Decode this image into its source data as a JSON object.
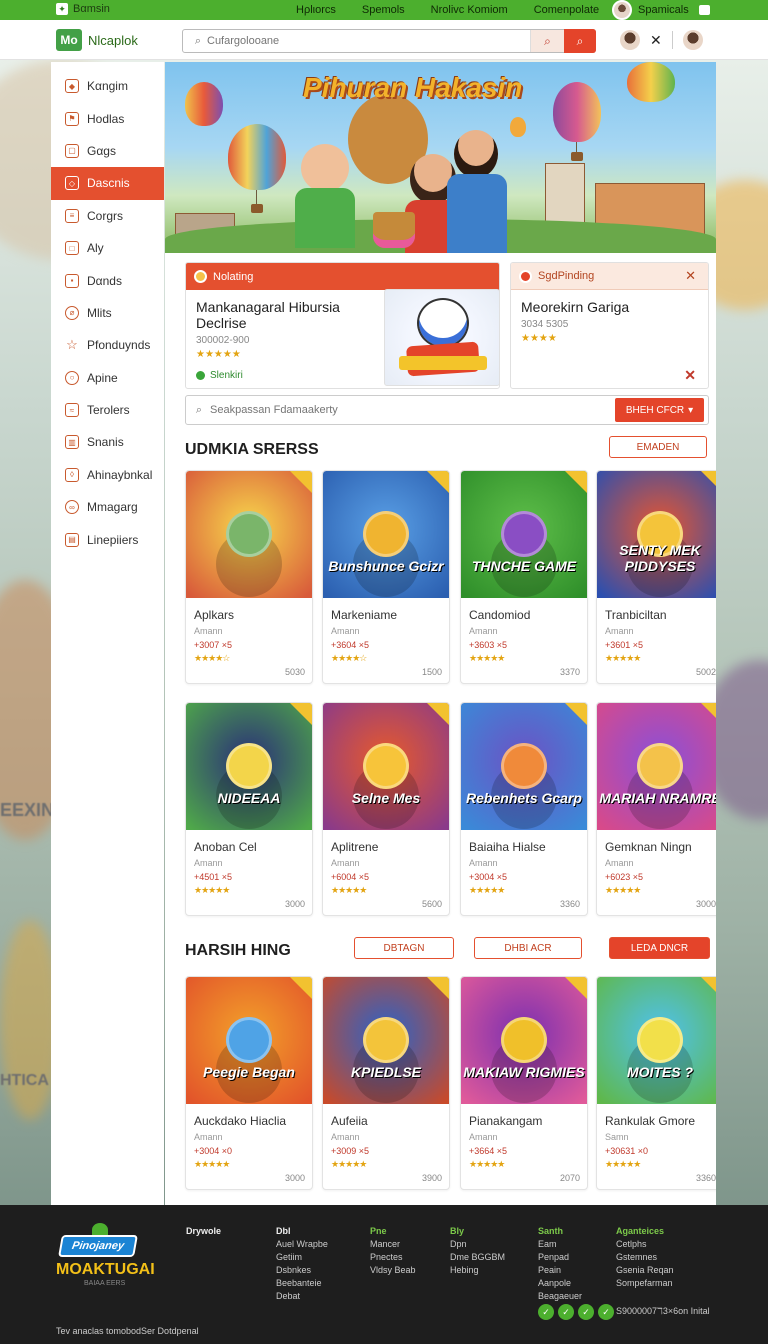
{
  "topbar": {
    "brand": "Bαmsin",
    "nav": [
      "Hρlιorcs",
      "Spemols",
      "Nrolivc Komiom",
      "Comenpolate"
    ],
    "account": "Spamicals"
  },
  "header": {
    "logo_mark": "Mo",
    "logo_text": "Nlcaplok",
    "search_placeholder": "Cufargolooane"
  },
  "sidebar": {
    "items": [
      {
        "label": "Kαngim",
        "icon": "tag-icon"
      },
      {
        "label": "Hodlas",
        "icon": "flag-icon"
      },
      {
        "label": "Gαgs",
        "icon": "gift-icon"
      },
      {
        "label": "Dascnis",
        "icon": "tag-icon",
        "active": true
      },
      {
        "label": "Corgrs",
        "icon": "document-icon"
      },
      {
        "label": "Aly",
        "icon": "box-icon"
      },
      {
        "label": "Dαnds",
        "icon": "square-icon"
      },
      {
        "label": "Mlits",
        "icon": "circle-slash-icon"
      },
      {
        "label": "Pfonduynds",
        "icon": "star-icon"
      },
      {
        "label": "Apine",
        "icon": "globe-icon"
      },
      {
        "label": "Terolers",
        "icon": "ticket-icon"
      },
      {
        "label": "Snanis",
        "icon": "building-icon"
      },
      {
        "label": "Ahinaybnkal",
        "icon": "shield-icon"
      },
      {
        "label": "Mmagarg",
        "icon": "link-icon"
      },
      {
        "label": "Linepiiers",
        "icon": "document-icon"
      }
    ]
  },
  "hero": {
    "title": "Pihuran Hakasin"
  },
  "featured": [
    {
      "header": "Nolating",
      "title": "Mankanagaral Hibursia Declrise",
      "sub": "300002-900",
      "rating": "★★★★★",
      "badge": "Slenkiri"
    },
    {
      "header": "SgdPinding",
      "title": "Meorekirn Gariga",
      "sub": "3034 5305",
      "rating": "★★★★"
    }
  ],
  "search2": {
    "placeholder": "Seakpassan Fdamaakerty",
    "button": "BHEH CFCR"
  },
  "section1": {
    "title": "UDMKIA SRERSS",
    "button": "EMADEN"
  },
  "section2": {
    "title": "HARSIH HING",
    "buttons": [
      "DBTAGN",
      "DHBI ACR",
      "LEDA DNCR"
    ]
  },
  "grid1": [
    {
      "name": "Aplkars",
      "sub": "Amann",
      "price": "+3007 ×5",
      "stars": "★★★★☆",
      "count": "5030",
      "band": ""
    },
    {
      "name": "Markeniame",
      "sub": "Amann",
      "price": "+3604 ×5",
      "stars": "★★★★☆",
      "count": "1500",
      "band": "Bunshunce Gcizr"
    },
    {
      "name": "Candomiod",
      "sub": "Amann",
      "price": "+3603 ×5",
      "stars": "★★★★★",
      "count": "3370",
      "band": "THNCHE GAME"
    },
    {
      "name": "Tranbiciltan",
      "sub": "Amann",
      "price": "+3601 ×5",
      "stars": "★★★★★",
      "count": "5002",
      "band": "SENTY MEK PIDDYSES"
    },
    {
      "name": "Anoban Cel",
      "sub": "Amann",
      "price": "+4501 ×5",
      "stars": "★★★★★",
      "count": "3000",
      "band": "NIDEEAA"
    },
    {
      "name": "Aplitrene",
      "sub": "Amann",
      "price": "+6004 ×5",
      "stars": "★★★★★",
      "count": "5600",
      "band": "Selne Mes"
    },
    {
      "name": "Baiaiha Hialse",
      "sub": "Amann",
      "price": "+3004 ×5",
      "stars": "★★★★★",
      "count": "3360",
      "band": "Rebenhets Gcarp"
    },
    {
      "name": "Gemknan Ningn",
      "sub": "Amann",
      "price": "+6023 ×5",
      "stars": "★★★★★",
      "count": "3000",
      "band": "MARIAH NRAMRE"
    }
  ],
  "grid2": [
    {
      "name": "Auckdako Hiaclia",
      "sub": "Amann",
      "price": "+3004 ×0",
      "stars": "★★★★★",
      "count": "3000",
      "band": "Peegie Began"
    },
    {
      "name": "Aufeiia",
      "sub": "Amann",
      "price": "+3009 ×5",
      "stars": "★★★★★",
      "count": "3900",
      "band": "KPIEDLSE"
    },
    {
      "name": "Pianakangam",
      "sub": "Amann",
      "price": "+3664 ×5",
      "stars": "★★★★★",
      "count": "2070",
      "band": "MAKIAW RIGMIES"
    },
    {
      "name": "Rankulak Gmore",
      "sub": "Samn",
      "price": "+30631 ×0",
      "stars": "★★★★★",
      "count": "3360",
      "band": "MOITES ?"
    }
  ],
  "footer": {
    "logo": "Pinojaney",
    "big": "MOAKTUGAI",
    "small": "BAIAA EERS",
    "cols": [
      {
        "h": "Drywole",
        "items": []
      },
      {
        "h": "Dbl",
        "items": [
          "Auel Wrapbe",
          "Getiim",
          "Dsbnkes",
          "Beebanteie",
          "Debat"
        ]
      },
      {
        "h": "Pne",
        "items": [
          "Mancer",
          "Pnectes",
          "Vldsy Beab"
        ]
      },
      {
        "h": "Bly",
        "items": [
          "Dpn",
          "Dme BGGBM",
          "Hebing"
        ]
      },
      {
        "h": "Santh",
        "items": [
          "Eam",
          "Penpad",
          "Peain",
          "Aanpole",
          "Beagaeuer"
        ]
      },
      {
        "h": "Aganteices",
        "items": [
          "Cetlphs",
          "Gstemnes",
          "Gsenia Reqan",
          "Sompefarman"
        ]
      }
    ],
    "contact": "S9000007ℸ3×6on Inital",
    "copy": "Tev anaclas tomobodSer Dotdpenal"
  },
  "colors": {
    "accent": "#e4442a",
    "green": "#4caf2e"
  }
}
